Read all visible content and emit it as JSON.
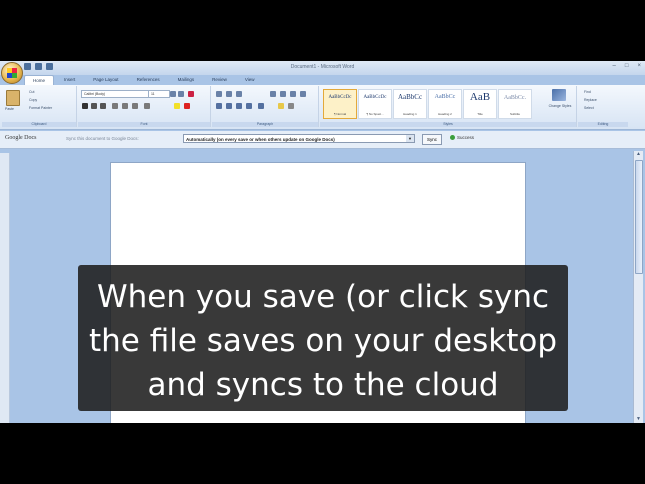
{
  "window": {
    "title": "Document1 - Microsoft Word",
    "controls": [
      "–",
      "□",
      "×"
    ]
  },
  "ribbon": {
    "tabs": [
      "Home",
      "Insert",
      "Page Layout",
      "References",
      "Mailings",
      "Review",
      "View"
    ],
    "clipboard": {
      "paste": "Paste",
      "cut": "Cut",
      "copy": "Copy",
      "format_painter": "Format Painter",
      "label": "Clipboard"
    },
    "font": {
      "name": "Calibri (Body)",
      "size": "11",
      "label": "Font"
    },
    "paragraph": {
      "label": "Paragraph"
    },
    "styles": {
      "items": [
        {
          "preview": "AaBbCcDc",
          "name": "¶ Normal"
        },
        {
          "preview": "AaBbCcDc",
          "name": "¶ No Spaci..."
        },
        {
          "preview": "AaBbCc",
          "name": "Heading 1"
        },
        {
          "preview": "AaBbCc",
          "name": "Heading 2"
        },
        {
          "preview": "AaB",
          "name": "Title"
        },
        {
          "preview": "AaBbCc.",
          "name": "Subtitle"
        }
      ],
      "change_styles": "Change Styles",
      "label": "Styles"
    },
    "editing": {
      "find": "Find",
      "replace": "Replace",
      "select": "Select",
      "label": "Editing"
    }
  },
  "gdocs_bar": {
    "logo": "Google Docs",
    "sync_label": "Sync this document to Google Docs:",
    "sync_option": "Automatically (on every save or when others update on Google Docs)",
    "sync_button": "Sync",
    "status": "Success"
  },
  "caption": {
    "lines": [
      "When you save (or click sync",
      "the file saves on your desktop",
      "and syncs to the cloud"
    ]
  },
  "colors": {
    "app_bg": "#a9c4e6",
    "caption_bg": "#1e1e1e",
    "status_ok": "#3b9e3b"
  }
}
